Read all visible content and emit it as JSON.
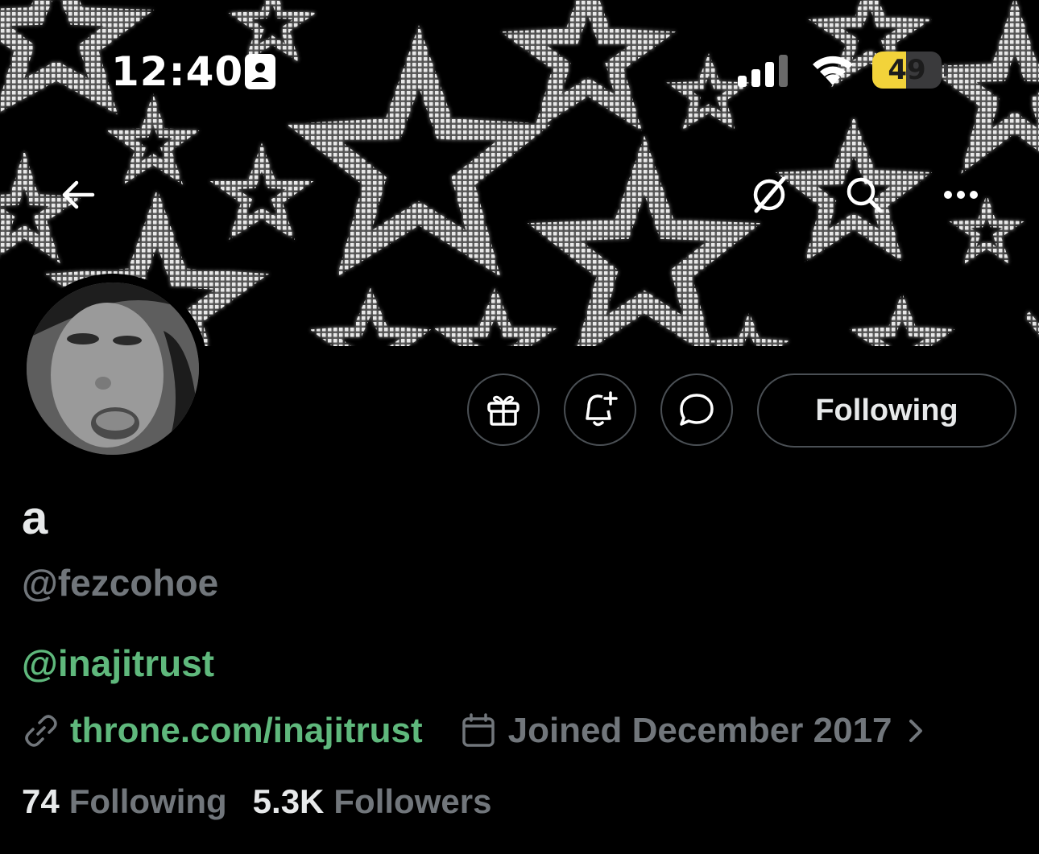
{
  "status_bar": {
    "time": "12:40",
    "battery_percent": 49
  },
  "nav": {
    "back_icon": "back-arrow-icon",
    "grok_icon": "grok-icon",
    "search_icon": "search-icon",
    "more_icon": "more-icon"
  },
  "profile": {
    "display_name": "a",
    "handle": "@fezcohoe",
    "bio_mention": "@inajitrust",
    "website": "throne.com/inajitrust",
    "joined": "Joined December 2017",
    "following_count": "74",
    "following_label": "Following",
    "followers_count": "5.3K",
    "followers_label": "Followers"
  },
  "actions": {
    "gift_icon": "gift-icon",
    "notify_icon": "bell-plus-icon",
    "message_icon": "message-bubble-icon",
    "follow_button_label": "Following"
  },
  "colors": {
    "link": "#5fb87c",
    "muted": "#71767b",
    "battery": "#f2d33a"
  }
}
